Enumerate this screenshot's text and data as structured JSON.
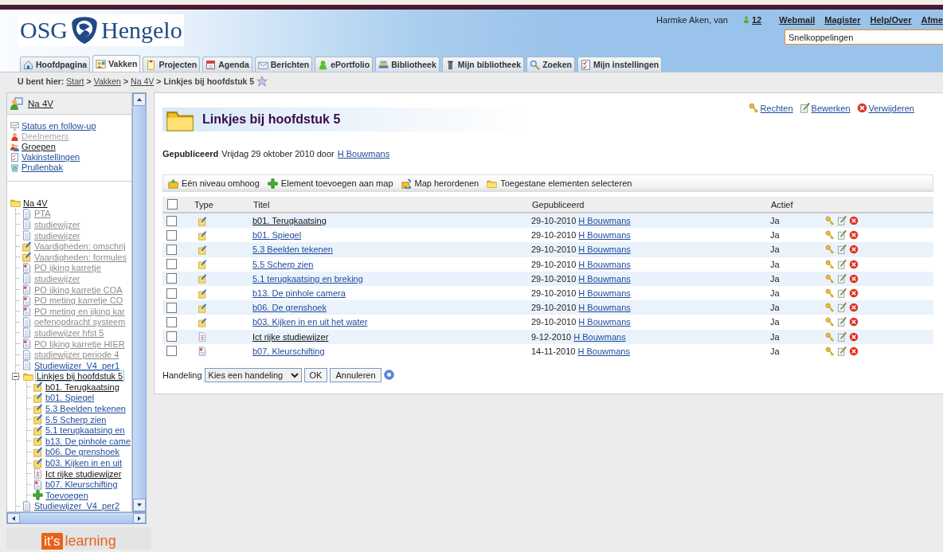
{
  "header": {
    "logo_left": "OSG",
    "logo_right": "Hengelo",
    "user": "Harmke Aken, van",
    "online_count": "12",
    "links": [
      "Webmail",
      "Magister",
      "Help/Over",
      "Afme"
    ],
    "shortcut_field": {
      "value": "Snelkoppelingen"
    }
  },
  "tabs": [
    {
      "label": "Hoofdpagina",
      "selected": false
    },
    {
      "label": "Vakken",
      "selected": true
    },
    {
      "label": "Projecten",
      "selected": false
    },
    {
      "label": "Agenda",
      "selected": false
    },
    {
      "label": "Berichten",
      "selected": false
    },
    {
      "label": "ePortfolio",
      "selected": false
    },
    {
      "label": "Bibliotheek",
      "selected": false
    },
    {
      "label": "Mijn bibliotheek",
      "selected": false
    },
    {
      "label": "Zoeken",
      "selected": false
    },
    {
      "label": "Mijn instellingen",
      "selected": false
    }
  ],
  "breadcrumb": [
    {
      "kind": "label",
      "text": "U bent hier:"
    },
    {
      "kind": "link",
      "text": "Start"
    },
    {
      "kind": "sep",
      "text": ">"
    },
    {
      "kind": "link",
      "text": "Vakken"
    },
    {
      "kind": "sep",
      "text": ">"
    },
    {
      "kind": "link",
      "text": "Na 4V"
    },
    {
      "kind": "sep",
      "text": ">"
    },
    {
      "kind": "current",
      "text": "Linkjes bij hoofdstuk 5"
    }
  ],
  "sidebar": {
    "course": "Na 4V",
    "menu": [
      {
        "label": "Status en follow-up",
        "disabled": false,
        "visited": false
      },
      {
        "label": "Deelnemers",
        "disabled": true,
        "visited": true
      },
      {
        "label": "Groepen",
        "disabled": false,
        "visited": true
      },
      {
        "label": "Vakinstellingen",
        "disabled": false,
        "visited": false
      },
      {
        "label": "Prullenbak",
        "disabled": false,
        "visited": false
      }
    ],
    "tree": {
      "label": "Na 4V",
      "kind": "folder",
      "faded": false,
      "visited": true,
      "selected": false,
      "expanded": true,
      "children": [
        {
          "label": "PTA",
          "kind": "page",
          "faded": true,
          "visited": true,
          "selected": false
        },
        {
          "label": "studiewijzer",
          "kind": "page",
          "faded": true,
          "visited": true,
          "selected": false
        },
        {
          "label": "studiewijzer",
          "kind": "page",
          "faded": true,
          "visited": true,
          "selected": false
        },
        {
          "label": "Vaardigheden: omschrij",
          "kind": "link",
          "faded": true,
          "visited": true,
          "selected": false
        },
        {
          "label": "Vaardigheden: formules",
          "kind": "link",
          "faded": true,
          "visited": true,
          "selected": false
        },
        {
          "label": "PO ijking karretje",
          "kind": "assignment",
          "faded": true,
          "visited": true,
          "selected": false
        },
        {
          "label": "studiewijzer",
          "kind": "page",
          "faded": true,
          "visited": true,
          "selected": false
        },
        {
          "label": "PO ijking karretje COA",
          "kind": "assignment",
          "faded": true,
          "visited": true,
          "selected": false
        },
        {
          "label": "PO meting karretje CO",
          "kind": "assignment",
          "faded": true,
          "visited": true,
          "selected": false
        },
        {
          "label": "PO meting en ijking kar",
          "kind": "assignment",
          "faded": true,
          "visited": true,
          "selected": false
        },
        {
          "label": "oefenopdracht systeem",
          "kind": "page",
          "faded": true,
          "visited": true,
          "selected": false
        },
        {
          "label": "studiewijzer hfst 5",
          "kind": "page",
          "faded": true,
          "visited": true,
          "selected": false
        },
        {
          "label": "PO Ijking karretje HIER",
          "kind": "assignment",
          "faded": true,
          "visited": true,
          "selected": false
        },
        {
          "label": "studiewijzer periode 4",
          "kind": "page",
          "faded": true,
          "visited": true,
          "selected": false
        },
        {
          "label": "Studiewijzer_V4_per1",
          "kind": "page",
          "faded": false,
          "visited": false,
          "selected": false
        },
        {
          "label": "Linkjes bij hoofdstuk 5",
          "kind": "folder",
          "faded": false,
          "visited": true,
          "selected": true,
          "expanded": true,
          "children": [
            {
              "label": "b01. Terugkaatsing",
              "kind": "link",
              "faded": false,
              "visited": true,
              "selected": false
            },
            {
              "label": "b01. Spiegel",
              "kind": "link",
              "faded": false,
              "visited": false,
              "selected": false
            },
            {
              "label": "5.3 Beelden tekenen",
              "kind": "link",
              "faded": false,
              "visited": false,
              "selected": false
            },
            {
              "label": "5.5 Scherp zien",
              "kind": "link",
              "faded": false,
              "visited": false,
              "selected": false
            },
            {
              "label": "5.1 terugkaatsing en",
              "kind": "link",
              "faded": false,
              "visited": false,
              "selected": false
            },
            {
              "label": "b13. De pinhole came",
              "kind": "link",
              "faded": false,
              "visited": false,
              "selected": false
            },
            {
              "label": "b06. De grenshoek",
              "kind": "link",
              "faded": false,
              "visited": false,
              "selected": false
            },
            {
              "label": "b03. Kijken in en uit",
              "kind": "link",
              "faded": false,
              "visited": false,
              "selected": false
            },
            {
              "label": "Ict rijke studiewijzer",
              "kind": "plan",
              "faded": false,
              "visited": true,
              "selected": false
            },
            {
              "label": "b07. Kleurschifting",
              "kind": "assignment",
              "faded": false,
              "visited": false,
              "selected": false
            },
            {
              "label": "Toevoegen",
              "kind": "add",
              "faded": false,
              "visited": false,
              "selected": false
            }
          ]
        },
        {
          "label": "Studiewijzer_V4_per2",
          "kind": "page",
          "faded": false,
          "visited": false,
          "selected": false
        }
      ]
    }
  },
  "logo": {
    "left": "it's",
    "right": "learning"
  },
  "main": {
    "title": "Linkjes bij hoofdstuk 5",
    "actions": [
      "Rechten",
      "Bewerken",
      "Verwijderen"
    ],
    "published": {
      "label": "Gepubliceerd",
      "text": "Vrijdag 29 oktober 2010 door",
      "author": "H Bouwmans"
    },
    "toolbar": [
      "Eén niveau omhoog",
      "Element toevoegen aan map",
      "Map herordenen",
      "Toegestane elementen selecteren"
    ],
    "table": {
      "select_all_checked": false,
      "columns": [
        "Type",
        "Titel",
        "Gepubliceerd",
        "Actief"
      ],
      "rows": [
        {
          "checked": false,
          "kind": "link",
          "title": "b01. Terugkaatsing",
          "visited": true,
          "date": "29-10-2010",
          "author": "H Bouwmans",
          "active": "Ja"
        },
        {
          "checked": false,
          "kind": "link",
          "title": "b01. Spiegel",
          "visited": false,
          "date": "29-10-2010",
          "author": "H Bouwmans",
          "active": "Ja"
        },
        {
          "checked": false,
          "kind": "link",
          "title": "5.3 Beelden tekenen",
          "visited": false,
          "date": "29-10-2010",
          "author": "H Bouwmans",
          "active": "Ja"
        },
        {
          "checked": false,
          "kind": "link",
          "title": "5.5 Scherp zien",
          "visited": false,
          "date": "29-10-2010",
          "author": "H Bouwmans",
          "active": "Ja"
        },
        {
          "checked": false,
          "kind": "link",
          "title": "5.1 terugkaatsing en breking",
          "visited": false,
          "date": "29-10-2010",
          "author": "H Bouwmans",
          "active": "Ja"
        },
        {
          "checked": false,
          "kind": "link",
          "title": "b13. De pinhole camera",
          "visited": false,
          "date": "29-10-2010",
          "author": "H Bouwmans",
          "active": "Ja"
        },
        {
          "checked": false,
          "kind": "link",
          "title": "b06. De grenshoek",
          "visited": false,
          "date": "29-10-2010",
          "author": "H Bouwmans",
          "active": "Ja"
        },
        {
          "checked": false,
          "kind": "link",
          "title": "b03. Kijken in en uit het water",
          "visited": false,
          "date": "29-10-2010",
          "author": "H Bouwmans",
          "active": "Ja"
        },
        {
          "checked": false,
          "kind": "plan",
          "title": "Ict rijke studiewijzer",
          "visited": true,
          "date": "9-12-2010",
          "author": "H Bouwmans",
          "active": "Ja"
        },
        {
          "checked": false,
          "kind": "assignment",
          "title": "b07. Kleurschifting",
          "visited": false,
          "date": "14-11-2010",
          "author": "H Bouwmans",
          "active": "Ja"
        }
      ]
    },
    "footer": {
      "label": "Handeling",
      "select": "Kies een handeling",
      "buttons": [
        "OK",
        "Annuleren"
      ]
    }
  }
}
